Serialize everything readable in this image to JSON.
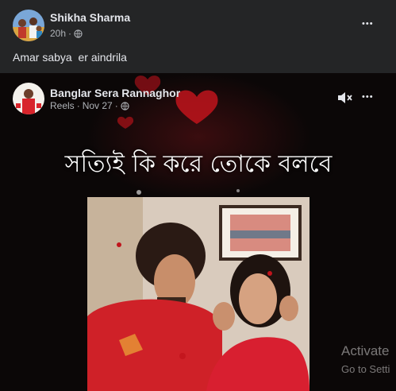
{
  "post": {
    "author": "Shikha Sharma",
    "time": "20h",
    "separator": "·",
    "audience_icon": "globe-icon",
    "text": "Amar sabya  er aindrila",
    "more_icon": "more-dots-icon",
    "more_label": "•••"
  },
  "shared": {
    "author": "Banglar Sera Rannaghor",
    "meta_prefix": "Reels",
    "separator": "·",
    "date": "Nov 27",
    "audience_icon": "globe-icon",
    "more_label": "•••",
    "caption": "সত্যিই কি করে তোকে বলবে",
    "mute_icon": "speaker-muted-icon"
  },
  "watermark": {
    "line1": "Activate",
    "line2": "Go to Setti"
  },
  "colors": {
    "panel": "#242526",
    "text": "#e4e6eb",
    "secondary": "#b0b3b8",
    "video_bg": "#0b0707",
    "heart": "#c0141c"
  }
}
